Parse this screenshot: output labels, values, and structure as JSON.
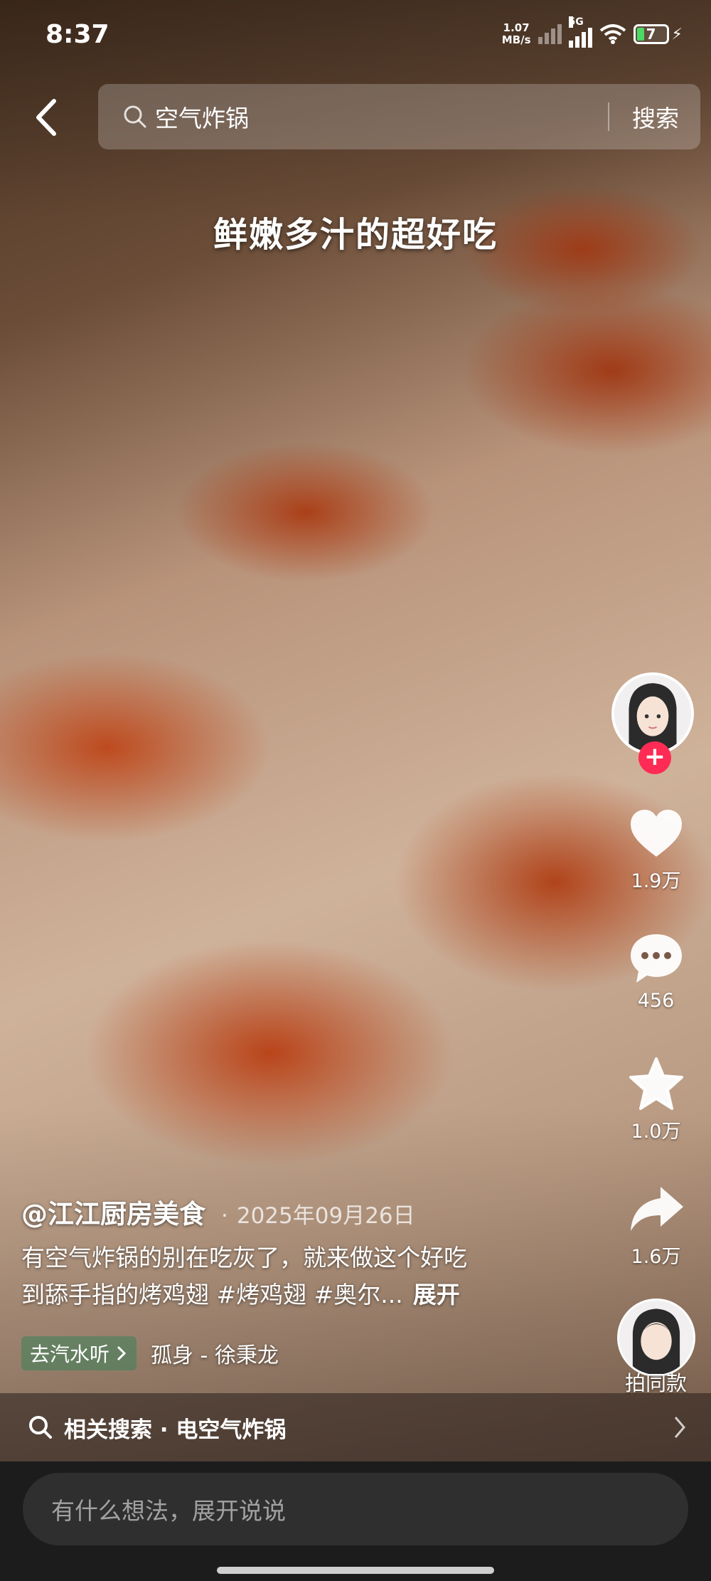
{
  "status_bar": {
    "time": "8:37",
    "net_speed_value": "1.07",
    "net_speed_unit": "MB/s",
    "network_type": "5G",
    "battery_level": "7"
  },
  "search": {
    "query": "空气炸锅",
    "button_label": "搜索"
  },
  "video": {
    "caption": "鲜嫩多汁的超好吃"
  },
  "actions": {
    "likes": "1.9万",
    "comments": "456",
    "favorites": "1.0万",
    "shares": "1.6万",
    "same_style_label": "拍同款",
    "follow_symbol": "+"
  },
  "post": {
    "author": "@江江厨房美食",
    "date": "2025年09月26日",
    "description_line1": "有空气炸锅的别在吃灰了，就来做这个好吃",
    "description_line2": "到舔手指的烤鸡翅 #烤鸡翅 #奥尔...",
    "expand_label": "展开",
    "music_tag": "去汽水听",
    "music_name": "孤身 - 徐秉龙"
  },
  "related_search": {
    "text": "相关搜索 · 电空气炸锅"
  },
  "comment_box": {
    "placeholder": "有什么想法，展开说说"
  },
  "colors": {
    "follow": "#fe2c55",
    "battery": "#4cd964"
  }
}
